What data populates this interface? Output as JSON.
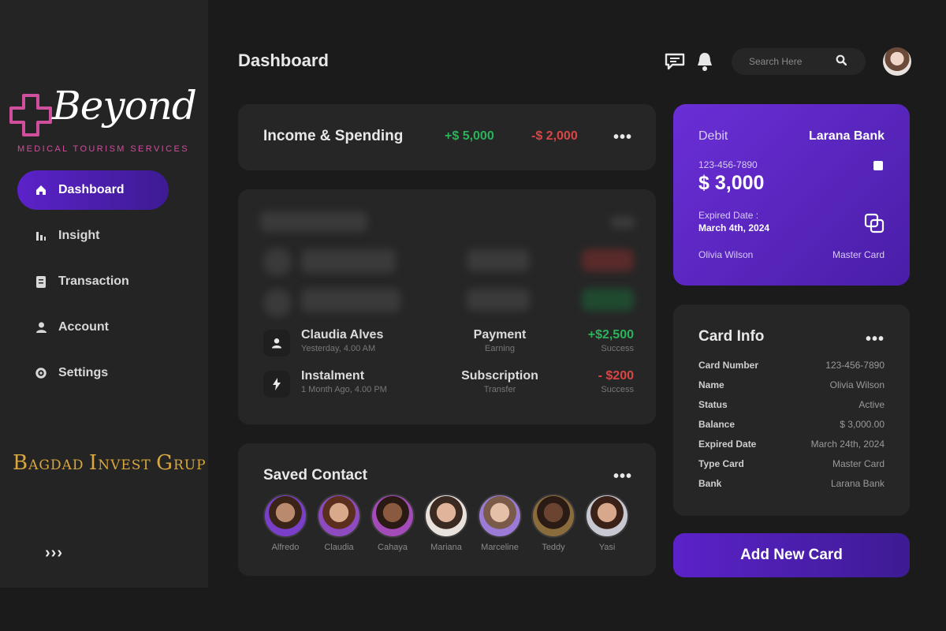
{
  "brand": {
    "name": "Beyond",
    "tagline": "MEDICAL TOURISM SERVICES",
    "partner": [
      "B",
      "AGDAD ",
      "I",
      "NVEST ",
      "G",
      "RUP"
    ]
  },
  "sidebar": {
    "items": [
      {
        "label": "Dashboard",
        "icon": "home-icon"
      },
      {
        "label": "Insight",
        "icon": "chart-icon"
      },
      {
        "label": "Transaction",
        "icon": "document-icon"
      },
      {
        "label": "Account",
        "icon": "user-icon"
      },
      {
        "label": "Settings",
        "icon": "gear-icon"
      }
    ],
    "collapse_label": "›››"
  },
  "header": {
    "title": "Dashboard",
    "search_placeholder": "Search Here"
  },
  "income": {
    "title": "Income & Spending",
    "plus": "+$ 5,000",
    "minus": "-$ 2,000",
    "more": "•••"
  },
  "transactions": {
    "rows": [
      {
        "name": "Claudia Alves",
        "sub": "Yesterday, 4.00 AM",
        "type": "Payment",
        "type_sub": "Earning",
        "amount": "+$2,500",
        "status": "Success",
        "icon": "user-icon"
      },
      {
        "name": "Instalment",
        "sub": "1 Month Ago, 4.00 PM",
        "type": "Subscription",
        "type_sub": "Transfer",
        "amount": "- $200",
        "status": "Success",
        "icon": "lightning-icon"
      }
    ]
  },
  "contacts": {
    "title": "Saved Contact",
    "more": "•••",
    "people": [
      {
        "name": "Alfredo",
        "color": "#7a3fc9"
      },
      {
        "name": "Claudia",
        "color": "#8e4abf"
      },
      {
        "name": "Cahaya",
        "color": "#a24bb9"
      },
      {
        "name": "Mariana",
        "color": "#e9e2dc"
      },
      {
        "name": "Marceline",
        "color": "#9c7bd6"
      },
      {
        "name": "Teddy",
        "color": "#8a6b3c"
      },
      {
        "name": "Yasi",
        "color": "#c8c8d2"
      }
    ]
  },
  "debit_card": {
    "label": "Debit",
    "bank": "Larana Bank",
    "number": "123-456-7890",
    "balance": "$ 3,000",
    "expired_label": "Expired Date :",
    "expired_value": "March 4th, 2024",
    "holder": "Olivia Wilson",
    "brand": "Master Card"
  },
  "card_info": {
    "title": "Card Info",
    "more": "•••",
    "rows": [
      {
        "key": "Card Number",
        "value": "123-456-7890"
      },
      {
        "key": "Name",
        "value": "Olivia Wilson"
      },
      {
        "key": "Status",
        "value": "Active"
      },
      {
        "key": "Balance",
        "value": "$ 3,000.00"
      },
      {
        "key": "Expired Date",
        "value": "March 24th, 2024"
      },
      {
        "key": "Type Card",
        "value": "Master Card"
      },
      {
        "key": "Bank",
        "value": "Larana Bank"
      }
    ]
  },
  "add_card_label": "Add New Card",
  "colors": {
    "accent": "#5b22c9",
    "positive": "#2bb35a",
    "negative": "#d84646",
    "brand_pink": "#d04f9c",
    "partner_gold": "#d9a73e"
  }
}
